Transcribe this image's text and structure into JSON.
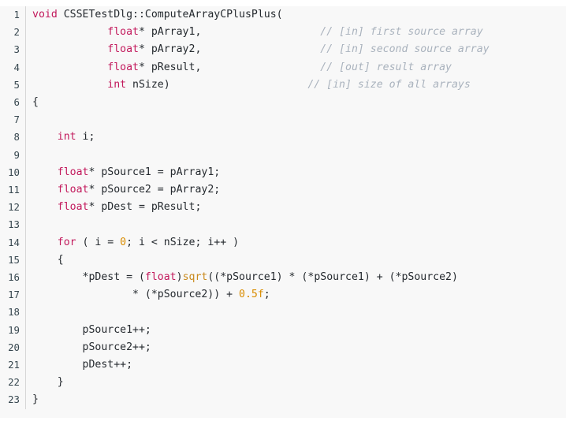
{
  "editor": {
    "language": "cpp",
    "background_color": "#f8f8f8",
    "gutter_divider_color": "#d6d6d6",
    "line_number_color": "#37474f",
    "colors": {
      "keyword": "#c2185b",
      "function": "#c98a1e",
      "number": "#d98c00",
      "comment": "#a9b2bd",
      "plain": "#24292e"
    },
    "first_line_number": 1,
    "last_line_number": 23,
    "total_lines": 23
  },
  "lines": [
    {
      "number": "1",
      "tokens": [
        {
          "t": "void",
          "c": "kw"
        },
        {
          "t": " CSSETestDlg::ComputeArrayCPlusPlus(",
          "c": "plain"
        }
      ]
    },
    {
      "number": "2",
      "tokens": [
        {
          "t": "            ",
          "c": "plain"
        },
        {
          "t": "float",
          "c": "kw"
        },
        {
          "t": "* pArray1,",
          "c": "plain"
        },
        {
          "t": "                   ",
          "c": "plain"
        },
        {
          "t": "// [in] first source array",
          "c": "cmt"
        }
      ]
    },
    {
      "number": "3",
      "tokens": [
        {
          "t": "            ",
          "c": "plain"
        },
        {
          "t": "float",
          "c": "kw"
        },
        {
          "t": "* pArray2,",
          "c": "plain"
        },
        {
          "t": "                   ",
          "c": "plain"
        },
        {
          "t": "// [in] second source array",
          "c": "cmt"
        }
      ]
    },
    {
      "number": "4",
      "tokens": [
        {
          "t": "            ",
          "c": "plain"
        },
        {
          "t": "float",
          "c": "kw"
        },
        {
          "t": "* pResult,",
          "c": "plain"
        },
        {
          "t": "                   ",
          "c": "plain"
        },
        {
          "t": "// [out] result array",
          "c": "cmt"
        }
      ]
    },
    {
      "number": "5",
      "tokens": [
        {
          "t": "            ",
          "c": "plain"
        },
        {
          "t": "int",
          "c": "kw"
        },
        {
          "t": " nSize)",
          "c": "plain"
        },
        {
          "t": "                      ",
          "c": "plain"
        },
        {
          "t": "// [in] size of all arrays",
          "c": "cmt"
        }
      ]
    },
    {
      "number": "6",
      "tokens": [
        {
          "t": "{",
          "c": "plain"
        }
      ]
    },
    {
      "number": "7",
      "tokens": [
        {
          "t": "",
          "c": "plain"
        }
      ]
    },
    {
      "number": "8",
      "tokens": [
        {
          "t": "    ",
          "c": "plain"
        },
        {
          "t": "int",
          "c": "kw"
        },
        {
          "t": " i;",
          "c": "plain"
        }
      ]
    },
    {
      "number": "9",
      "tokens": [
        {
          "t": "",
          "c": "plain"
        }
      ]
    },
    {
      "number": "10",
      "tokens": [
        {
          "t": "    ",
          "c": "plain"
        },
        {
          "t": "float",
          "c": "kw"
        },
        {
          "t": "* pSource1 = pArray1;",
          "c": "plain"
        }
      ]
    },
    {
      "number": "11",
      "tokens": [
        {
          "t": "    ",
          "c": "plain"
        },
        {
          "t": "float",
          "c": "kw"
        },
        {
          "t": "* pSource2 = pArray2;",
          "c": "plain"
        }
      ]
    },
    {
      "number": "12",
      "tokens": [
        {
          "t": "    ",
          "c": "plain"
        },
        {
          "t": "float",
          "c": "kw"
        },
        {
          "t": "* pDest = pResult;",
          "c": "plain"
        }
      ]
    },
    {
      "number": "13",
      "tokens": [
        {
          "t": "",
          "c": "plain"
        }
      ]
    },
    {
      "number": "14",
      "tokens": [
        {
          "t": "    ",
          "c": "plain"
        },
        {
          "t": "for",
          "c": "kw"
        },
        {
          "t": " ( i = ",
          "c": "plain"
        },
        {
          "t": "0",
          "c": "num"
        },
        {
          "t": "; i < nSize; i++ )",
          "c": "plain"
        }
      ]
    },
    {
      "number": "15",
      "tokens": [
        {
          "t": "    {",
          "c": "plain"
        }
      ]
    },
    {
      "number": "16",
      "tokens": [
        {
          "t": "        *pDest = (",
          "c": "plain"
        },
        {
          "t": "float",
          "c": "kw"
        },
        {
          "t": ")",
          "c": "plain"
        },
        {
          "t": "sqrt",
          "c": "fn"
        },
        {
          "t": "((*pSource1) * (*pSource1) + (*pSource2)",
          "c": "plain"
        }
      ]
    },
    {
      "number": "17",
      "tokens": [
        {
          "t": "                * (*pSource2)) + ",
          "c": "plain"
        },
        {
          "t": "0.5f",
          "c": "num"
        },
        {
          "t": ";",
          "c": "plain"
        }
      ]
    },
    {
      "number": "18",
      "tokens": [
        {
          "t": "",
          "c": "plain"
        }
      ]
    },
    {
      "number": "19",
      "tokens": [
        {
          "t": "        pSource1++;",
          "c": "plain"
        }
      ]
    },
    {
      "number": "20",
      "tokens": [
        {
          "t": "        pSource2++;",
          "c": "plain"
        }
      ]
    },
    {
      "number": "21",
      "tokens": [
        {
          "t": "        pDest++;",
          "c": "plain"
        }
      ]
    },
    {
      "number": "22",
      "tokens": [
        {
          "t": "    }",
          "c": "plain"
        }
      ]
    },
    {
      "number": "23",
      "tokens": [
        {
          "t": "}",
          "c": "plain"
        }
      ]
    }
  ]
}
